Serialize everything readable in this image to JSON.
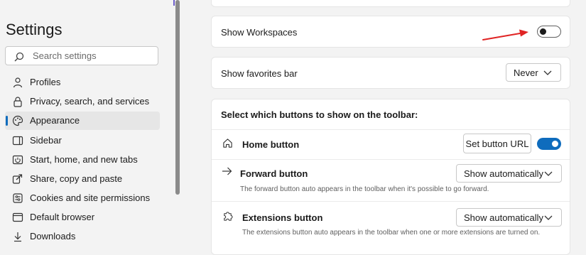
{
  "sidebar": {
    "title": "Settings",
    "search_placeholder": "Search settings",
    "items": [
      {
        "label": "Profiles",
        "icon": "profiles-icon"
      },
      {
        "label": "Privacy, search, and services",
        "icon": "lock-icon"
      },
      {
        "label": "Appearance",
        "icon": "appearance-icon",
        "active": true
      },
      {
        "label": "Sidebar",
        "icon": "sidebar-icon"
      },
      {
        "label": "Start, home, and new tabs",
        "icon": "power-icon"
      },
      {
        "label": "Share, copy and paste",
        "icon": "share-icon"
      },
      {
        "label": "Cookies and site permissions",
        "icon": "cookies-icon"
      },
      {
        "label": "Default browser",
        "icon": "browser-icon"
      },
      {
        "label": "Downloads",
        "icon": "download-icon"
      }
    ]
  },
  "main": {
    "workspaces": {
      "label": "Show Workspaces",
      "enabled": false
    },
    "favorites_bar": {
      "label": "Show favorites bar",
      "value": "Never"
    },
    "toolbar": {
      "heading": "Select which buttons to show on the toolbar:",
      "home": {
        "label": "Home button",
        "button_label": "Set button URL",
        "enabled": true
      },
      "forward": {
        "label": "Forward button",
        "value": "Show automatically",
        "description": "The forward button auto appears in the toolbar when it's possible to go forward."
      },
      "extensions": {
        "label": "Extensions button",
        "value": "Show automatically",
        "description": "The extensions button auto appears in the toolbar when one or more extensions are turned on."
      }
    }
  },
  "colors": {
    "accent": "#0f6cbd",
    "annotation_arrow": "#e02424"
  }
}
